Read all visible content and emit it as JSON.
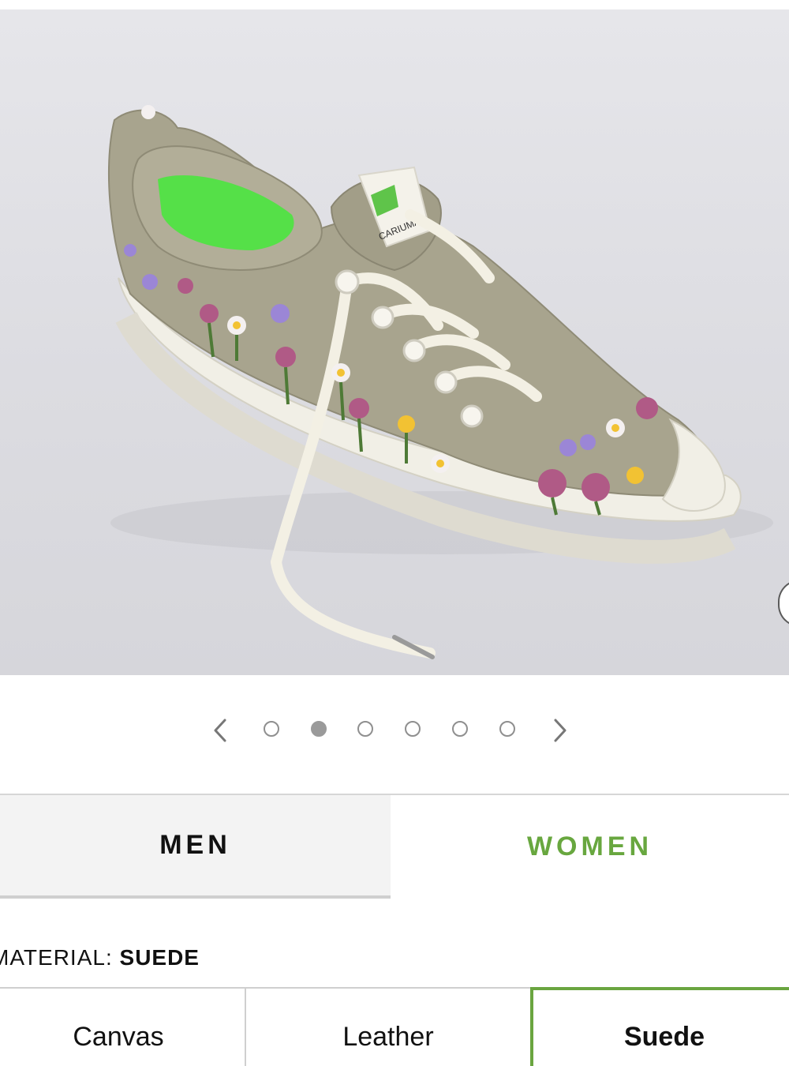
{
  "product_image": {
    "alt": "embroidered suede sneaker",
    "brand_tag": "CARIUMA"
  },
  "carousel": {
    "total_slides": 6,
    "active_index": 1
  },
  "gender": {
    "men_label": "MEN",
    "women_label": "WOMEN",
    "selected": "WOMEN"
  },
  "material": {
    "label": "MATERIAL: ",
    "value": "SUEDE",
    "options": [
      "Canvas",
      "Leather",
      "Suede"
    ]
  },
  "colors": {
    "accent": "#68a73f",
    "selected_border": "#6aa540",
    "dot_active": "#9a9a9a"
  }
}
